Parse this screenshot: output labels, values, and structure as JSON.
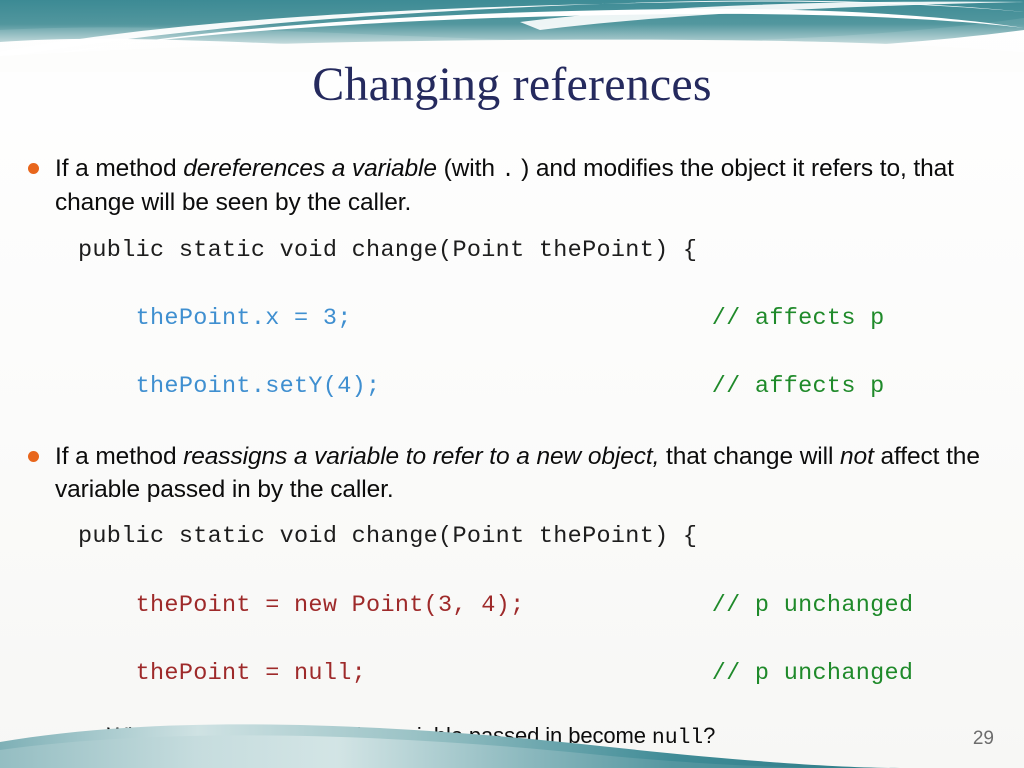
{
  "slide": {
    "title": "Changing references",
    "page_number": "29",
    "accent_header_color": "#3f8b96",
    "accent_footer_color": "#3f8b96",
    "title_color": "#252a5e",
    "bullet_color": "#e8661c",
    "sub_bullet_color": "#6b93c0"
  },
  "bullets": [
    {
      "id": "bullet-1",
      "level": 1,
      "runs": [
        {
          "text": "If a method ",
          "style": "normal"
        },
        {
          "text": "dereferences a variable",
          "style": "italic"
        },
        {
          "text": "  (with ",
          "style": "normal"
        },
        {
          "text": ".",
          "style": "mono"
        },
        {
          "text": " ) and modifies the object it refers to, that change will be seen by the caller.",
          "style": "normal"
        }
      ]
    },
    {
      "id": "bullet-2",
      "level": 1,
      "runs": [
        {
          "text": "If a method ",
          "style": "normal"
        },
        {
          "text": "reassigns a variable to refer to a new object,",
          "style": "italic"
        },
        {
          "text": " that change will ",
          "style": "normal"
        },
        {
          "text": "not",
          "style": "italic"
        },
        {
          "text": " affect the variable passed in by the caller.",
          "style": "normal"
        }
      ]
    },
    {
      "id": "bullet-3",
      "level": 2,
      "runs": [
        {
          "text": "What if we want to make the variable passed in become ",
          "style": "normal"
        },
        {
          "text": "null",
          "style": "mono"
        },
        {
          "text": "?",
          "style": "normal"
        }
      ]
    }
  ],
  "code_blocks": [
    {
      "id": "code-block-1",
      "lines": [
        {
          "code": "public static void change(Point thePoint) {",
          "code_color": "sig",
          "comment": "",
          "comment_color": "cmt"
        },
        {
          "code": "    thePoint.x = 3;",
          "code_color": "blue",
          "comment": "// affects p",
          "comment_color": "cmt"
        },
        {
          "code": "    thePoint.setY(4);",
          "code_color": "blue",
          "comment": "// affects p",
          "comment_color": "cmt"
        }
      ]
    },
    {
      "id": "code-block-2",
      "lines": [
        {
          "code": "public static void change(Point thePoint) {",
          "code_color": "sig",
          "comment": "",
          "comment_color": "cmt"
        },
        {
          "code": "    thePoint = new Point(3, 4);",
          "code_color": "red",
          "comment": "// p unchanged",
          "comment_color": "cmt"
        },
        {
          "code": "    thePoint = null;",
          "code_color": "red",
          "comment": "// p unchanged",
          "comment_color": "cmt"
        }
      ]
    }
  ],
  "colors": {
    "code_signature": "#1d1d1d",
    "code_blue": "#3f8fd0",
    "code_red": "#9e2a2a",
    "code_comment": "#1f8a2a"
  }
}
